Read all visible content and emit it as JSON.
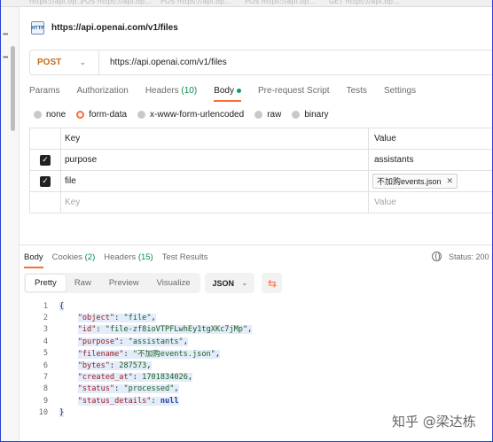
{
  "tabstrip": {
    "ghost_tabs": [
      "https://api.op...",
      "POS https://api.op...",
      "POS https://api.op...",
      "POS https://api.op...",
      "GET https://api.op..."
    ]
  },
  "request": {
    "icon_label": "HTTP",
    "title": "https://api.openai.com/v1/files",
    "method": "POST",
    "url": "https://api.openai.com/v1/files"
  },
  "request_tabs": [
    {
      "label": "Params",
      "count": ""
    },
    {
      "label": "Authorization",
      "count": ""
    },
    {
      "label": "Headers ",
      "count": "(10)"
    },
    {
      "label": "Body",
      "count": ""
    },
    {
      "label": "Pre-request Script",
      "count": ""
    },
    {
      "label": "Tests",
      "count": ""
    },
    {
      "label": "Settings",
      "count": ""
    }
  ],
  "body_types": [
    "none",
    "form-data",
    "x-www-form-urlencoded",
    "raw",
    "binary"
  ],
  "body_type_selected": "form-data",
  "form_table": {
    "headers": {
      "key": "Key",
      "value": "Value"
    },
    "rows": [
      {
        "key": "purpose",
        "value": "assistants",
        "checked": true
      },
      {
        "key": "file",
        "value": "不加购events.json",
        "checked": true
      }
    ],
    "placeholder": {
      "key": "Key",
      "value": "Value"
    }
  },
  "response_tabs": [
    {
      "label": "Body",
      "count": ""
    },
    {
      "label": "Cookies ",
      "count": "(2)"
    },
    {
      "label": "Headers ",
      "count": "(15)"
    },
    {
      "label": "Test Results",
      "count": ""
    }
  ],
  "status_text": "Status: 200",
  "view_modes": [
    "Pretty",
    "Raw",
    "Preview",
    "Visualize"
  ],
  "format": "JSON",
  "code_lines": [
    {
      "n": "1",
      "text": "{"
    },
    {
      "n": "2",
      "key": "\"object\"",
      "val": "\"file\"",
      "type": "str",
      "comma": ","
    },
    {
      "n": "3",
      "key": "\"id\"",
      "val": "\"file-zf8ioVTPFLwhEy1tgXKc7jMp\"",
      "type": "str",
      "comma": ","
    },
    {
      "n": "4",
      "key": "\"purpose\"",
      "val": "\"assistants\"",
      "type": "str",
      "comma": ","
    },
    {
      "n": "5",
      "key": "\"filename\"",
      "val": "\"不加购events.json\"",
      "type": "str",
      "comma": ","
    },
    {
      "n": "6",
      "key": "\"bytes\"",
      "val": "287573",
      "type": "num",
      "comma": ","
    },
    {
      "n": "7",
      "key": "\"created_at\"",
      "val": "1701834026",
      "type": "num",
      "comma": ","
    },
    {
      "n": "8",
      "key": "\"status\"",
      "val": "\"processed\"",
      "type": "str",
      "comma": ","
    },
    {
      "n": "9",
      "key": "\"status_details\"",
      "val": "null",
      "type": "null",
      "comma": ""
    },
    {
      "n": "10",
      "text": "}"
    }
  ],
  "watermark": "知乎 @梁达栋",
  "colors": {
    "accent": "#ff6c37",
    "method": "#c56a1a",
    "count_green": "#0b8a4a",
    "string": "#1b5e20",
    "key": "#9b1b1b",
    "null": "#1f3fa6"
  }
}
